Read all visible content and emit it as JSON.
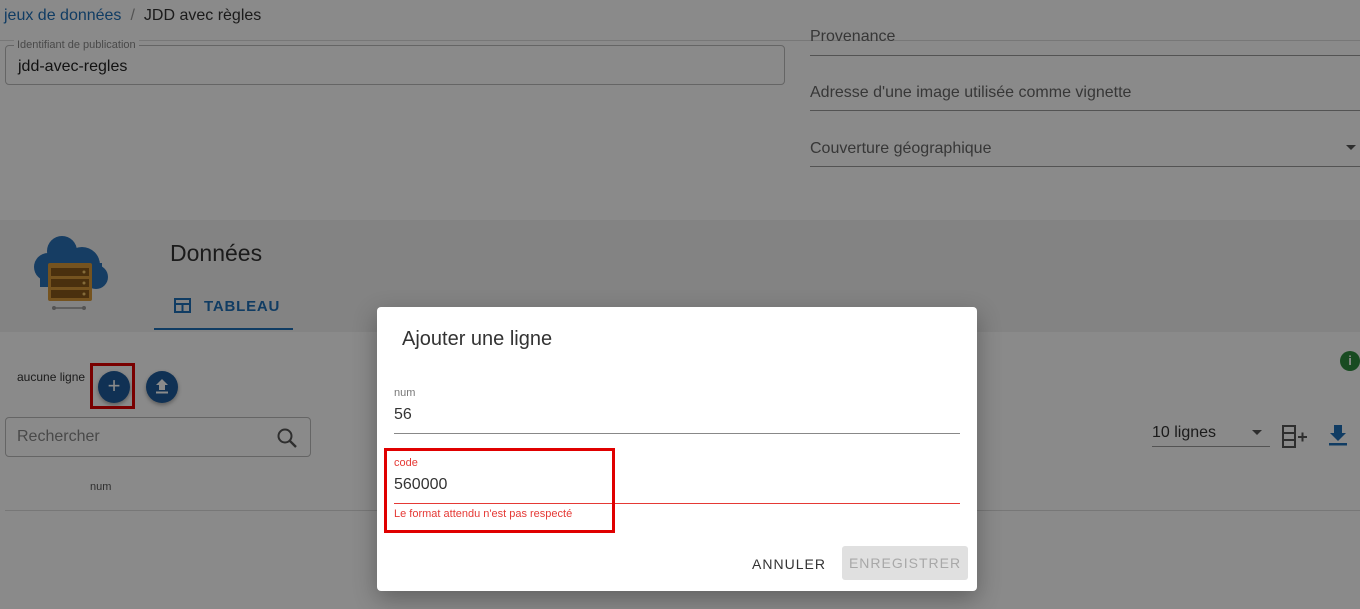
{
  "breadcrumb": {
    "parent": "jeux de données",
    "separator": "/",
    "current": "JDD avec règles"
  },
  "form": {
    "publication_id": {
      "label": "Identifiant de publication",
      "value": "jdd-avec-regles"
    },
    "provenance_label": "Provenance",
    "thumbnail_label": "Adresse d'une image utilisée comme vignette",
    "coverage_label": "Couverture géographique"
  },
  "data_section": {
    "title": "Données",
    "tab_label": "TABLEAU",
    "no_rows": "aucune ligne",
    "search_placeholder": "Rechercher",
    "column_header": "num",
    "rows_per_page": "10 lignes"
  },
  "dialog": {
    "title": "Ajouter une ligne",
    "num": {
      "label": "num",
      "value": "56"
    },
    "code": {
      "label": "code",
      "value": "560000",
      "error": "Le format attendu n'est pas respecté"
    },
    "cancel_label": "ANNULER",
    "save_label": "ENREGISTRER"
  },
  "icons": {
    "add": "plus-icon",
    "upload": "upload-icon",
    "search": "search-icon",
    "info": "info-icon",
    "add_column": "add-column-icon",
    "download": "download-icon",
    "table": "table-icon",
    "logo": "cloud-server-icon"
  },
  "colors": {
    "primary": "#1e6fb8",
    "fab": "#1e5c9b",
    "error": "#e53935",
    "highlight": "#e00000",
    "info": "#2e8b3e"
  }
}
